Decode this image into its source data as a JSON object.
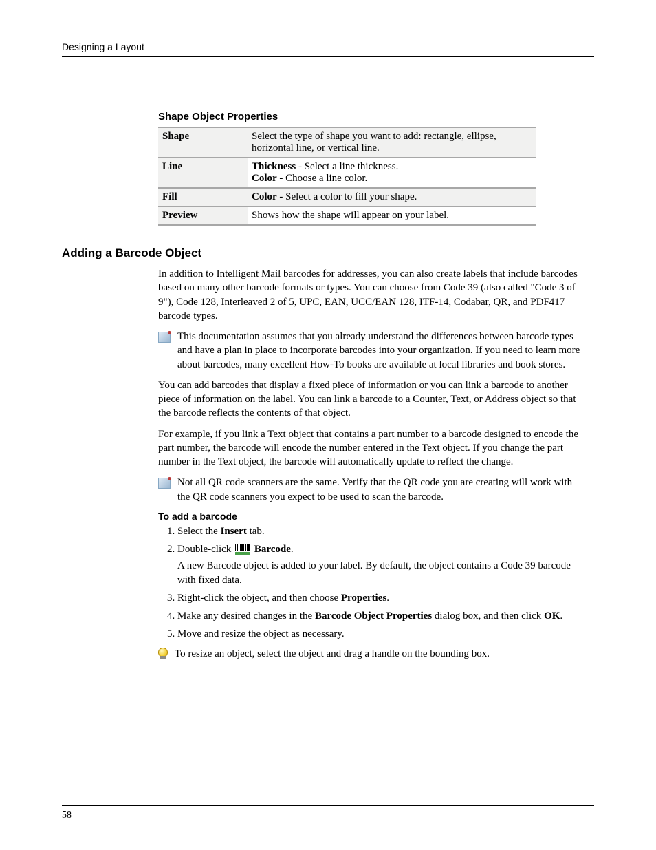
{
  "header": {
    "running_title": "Designing a Layout"
  },
  "shape_table": {
    "title": "Shape Object Properties",
    "rows": [
      {
        "name": "Shape",
        "desc": "Select the type of shape you want to add: rectangle, ellipse, horizontal line, or vertical line."
      },
      {
        "name": "Line",
        "desc_parts": [
          {
            "bold": "Thickness",
            "rest": " - Select a line thickness."
          },
          {
            "bold": "Color",
            "rest": " - Choose a line color."
          }
        ]
      },
      {
        "name": "Fill",
        "desc_parts": [
          {
            "bold": "Color",
            "rest": " - Select a color to fill your shape."
          }
        ]
      },
      {
        "name": "Preview",
        "desc": "Shows how the shape will appear on your label."
      }
    ]
  },
  "section": {
    "heading": "Adding a Barcode Object",
    "para1": "In addition to Intelligent Mail barcodes for addresses, you can also create labels that include barcodes based on many other barcode formats or types. You can choose from Code 39 (also called \"Code 3 of 9\"), Code 128, Interleaved 2 of 5, UPC, EAN, UCC/EAN 128, ITF-14, Codabar, QR, and PDF417 barcode types.",
    "note1": "This documentation assumes that you already understand the differences between barcode types and have a plan in place to incorporate barcodes into your organization. If you need to learn more about barcodes, many excellent How-To books are available at local libraries and book stores.",
    "para2": "You can add barcodes that display a fixed piece of information or you can link a barcode to another piece of information on the label. You can link a barcode to a Counter, Text, or Address object so that the barcode reflects the contents of that object.",
    "para3": "For example, if you link a Text object that contains a part number to a barcode designed to encode the part number, the barcode will encode the number entered in the Text object. If you change the part number in the Text object, the barcode will automatically update to reflect the change.",
    "note2": "Not all QR code scanners are the same. Verify that the QR code you are creating will work with the QR code scanners you expect to be used to scan the barcode.",
    "procedure_title": "To add a barcode",
    "steps": {
      "s1_a": "Select the ",
      "s1_b": "Insert",
      "s1_c": " tab.",
      "s2_a": "Double-click ",
      "s2_b": " Barcode",
      "s2_c": ".",
      "s2_extra": "A new Barcode object is added to your label. By default, the object contains a Code 39 barcode with fixed data.",
      "s3_a": "Right-click the object, and then choose ",
      "s3_b": "Properties",
      "s3_c": ".",
      "s4_a": "Make any desired changes in the ",
      "s4_b": "Barcode Object Properties",
      "s4_c": " dialog box, and then click ",
      "s4_d": "OK",
      "s4_e": ".",
      "s5": "Move and resize the object as necessary."
    },
    "tip": "To resize an object, select the object and drag a handle on the bounding box."
  },
  "footer": {
    "page_number": "58"
  }
}
